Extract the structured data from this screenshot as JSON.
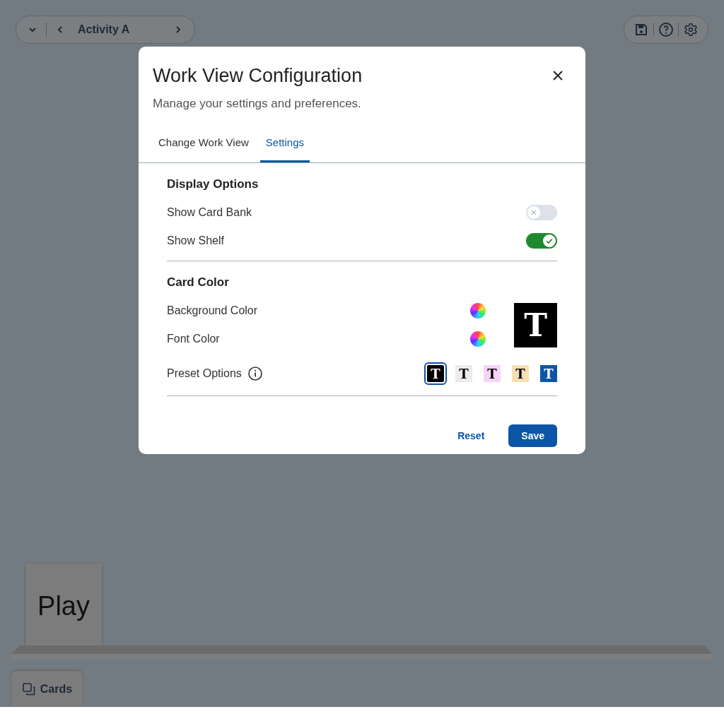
{
  "activity_nav": {
    "title": "Activity A"
  },
  "shelf": {
    "cards": [
      {
        "label": "Play"
      }
    ]
  },
  "cards_tab": {
    "label": "Cards"
  },
  "dialog": {
    "title": "Work View Configuration",
    "subtitle": "Manage your settings and preferences.",
    "tabs": [
      {
        "label": "Change Work View",
        "selected": false
      },
      {
        "label": "Settings",
        "selected": true
      }
    ],
    "display_options": {
      "heading": "Display Options",
      "toggles": [
        {
          "label": "Show Card Bank",
          "on": false
        },
        {
          "label": "Show Shelf",
          "on": true
        }
      ]
    },
    "card_color": {
      "heading": "Card Color",
      "background_label": "Background Color",
      "font_label": "Font Color",
      "preview_label": "T",
      "preset_label": "Preset Options",
      "presets": [
        {
          "label": "T",
          "color": "#000000",
          "selected": true
        },
        {
          "label": "T",
          "color": "#ececec",
          "selected": false
        },
        {
          "label": "T",
          "color": "#f5d4f7",
          "selected": false
        },
        {
          "label": "T",
          "color": "#f7dfb4",
          "selected": false
        },
        {
          "label": "T",
          "color": "#0b56a6",
          "selected": false
        }
      ]
    },
    "buttons": {
      "reset": "Reset",
      "save": "Save"
    }
  }
}
